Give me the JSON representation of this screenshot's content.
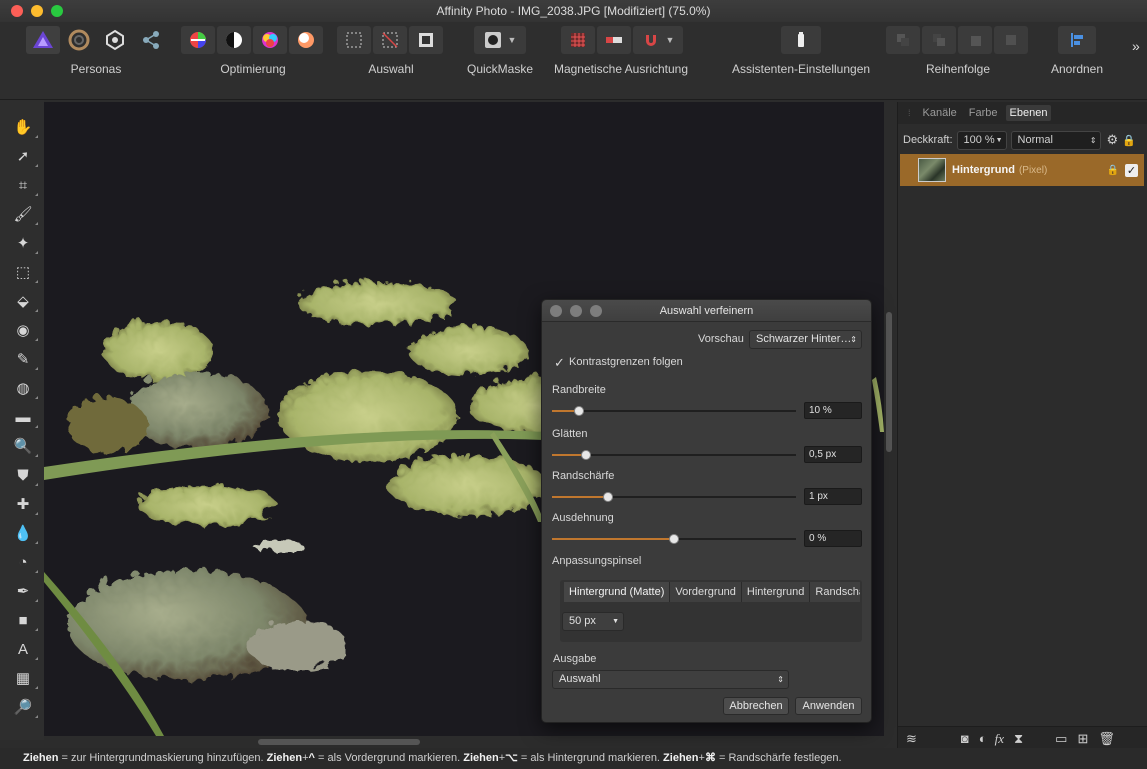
{
  "window": {
    "title": "Affinity Photo - IMG_2038.JPG [Modifiziert] (75.0%)"
  },
  "toolbar": {
    "groups": {
      "personas": "Personas",
      "optimierung": "Optimierung",
      "auswahl": "Auswahl",
      "quickmaske": "QuickMaske",
      "magnetisch": "Magnetische Ausrichtung",
      "assistent": "Assistenten-Einstellungen",
      "reihenfolge": "Reihenfolge",
      "anordnen": "Anordnen"
    },
    "overflow": "»",
    "colors": {
      "accent": "#7a4bd8",
      "warning": "#d84646",
      "brand": "#5b3fcb"
    }
  },
  "tools": [
    {
      "name": "hand-tool-icon",
      "glyph": "✋"
    },
    {
      "name": "move-tool-icon",
      "glyph": "➚"
    },
    {
      "name": "crop-tool-icon",
      "glyph": "⌗"
    },
    {
      "name": "selection-brush-icon",
      "glyph": "🖌"
    },
    {
      "name": "flood-select-icon",
      "glyph": "✦"
    },
    {
      "name": "marquee-tool-icon",
      "glyph": "⬚"
    },
    {
      "name": "flood-fill-icon",
      "glyph": "⬙"
    },
    {
      "name": "color-picker-icon",
      "glyph": "◉"
    },
    {
      "name": "paint-brush-icon",
      "glyph": "✎"
    },
    {
      "name": "color-replace-icon",
      "glyph": "◍"
    },
    {
      "name": "eraser-icon",
      "glyph": "▬"
    },
    {
      "name": "dodge-icon",
      "glyph": "🔍"
    },
    {
      "name": "clone-icon",
      "glyph": "⛊"
    },
    {
      "name": "healing-icon",
      "glyph": "✚"
    },
    {
      "name": "blur-icon",
      "glyph": "💧"
    },
    {
      "name": "red-eye-icon",
      "glyph": "◔"
    },
    {
      "name": "pen-tool-icon",
      "glyph": "✒"
    },
    {
      "name": "shape-tool-icon",
      "glyph": "■"
    },
    {
      "name": "text-tool-icon",
      "glyph": "A"
    },
    {
      "name": "mesh-warp-icon",
      "glyph": "▦"
    },
    {
      "name": "zoom-tool-icon",
      "glyph": "🔎"
    }
  ],
  "panel": {
    "tabs": [
      "Kanäle",
      "Farbe",
      "Ebenen"
    ],
    "active_tab": "Ebenen",
    "opacity_label": "Deckkraft:",
    "opacity_value": "100 %",
    "blend_mode": "Normal",
    "layer": {
      "name": "Hintergrund",
      "kind": "(Pixel)"
    }
  },
  "dialog": {
    "title": "Auswahl verfeinern",
    "preview_label": "Vorschau",
    "preview_value": "Schwarzer Hinter…",
    "contrast_label": "Kontrastgrenzen folgen",
    "contrast_checked": true,
    "sliders": [
      {
        "label": "Randbreite",
        "value": "10 %",
        "fraction": 0.11
      },
      {
        "label": "Glätten",
        "value": "0,5 px",
        "fraction": 0.14
      },
      {
        "label": "Randschärfe",
        "value": "1 px",
        "fraction": 0.23
      },
      {
        "label": "Ausdehnung",
        "value": "0 %",
        "fraction": 0.5
      }
    ],
    "brush_label": "Anpassungspinsel",
    "brush_tabs": [
      "Hintergrund (Matte)",
      "Vordergrund",
      "Hintergrund",
      "Randschä"
    ],
    "brush_size": "50 px",
    "output_label": "Ausgabe",
    "output_value": "Auswahl",
    "cancel": "Abbrechen",
    "apply": "Anwenden"
  },
  "status": {
    "parts": [
      {
        "bold": "Ziehen",
        "text": " = zur Hintergrundmaskierung hinzufügen. "
      },
      {
        "bold": "Ziehen",
        "text": "+"
      },
      {
        "bold": "^",
        "text": " = als Vordergrund markieren. "
      },
      {
        "bold": "Ziehen",
        "text": "+"
      },
      {
        "bold": "⌥",
        "text": " = als Hintergrund markieren. "
      },
      {
        "bold": "Ziehen",
        "text": "+"
      },
      {
        "bold": "⌘",
        "text": " = Randschärfe festlegen."
      }
    ]
  }
}
